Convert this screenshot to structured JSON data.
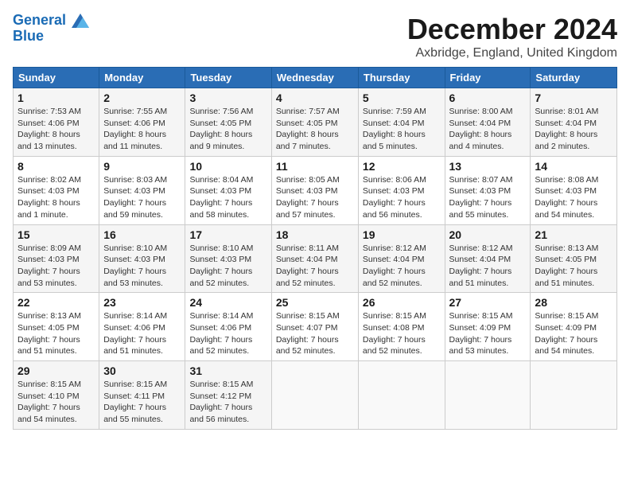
{
  "logo": {
    "line1": "General",
    "line2": "Blue"
  },
  "title": "December 2024",
  "subtitle": "Axbridge, England, United Kingdom",
  "colors": {
    "header_bg": "#2a6db5",
    "accent": "#1a6bb5"
  },
  "days_of_week": [
    "Sunday",
    "Monday",
    "Tuesday",
    "Wednesday",
    "Thursday",
    "Friday",
    "Saturday"
  ],
  "weeks": [
    [
      {
        "day": "1",
        "sunrise": "7:53 AM",
        "sunset": "4:06 PM",
        "daylight": "8 hours and 13 minutes."
      },
      {
        "day": "2",
        "sunrise": "7:55 AM",
        "sunset": "4:06 PM",
        "daylight": "8 hours and 11 minutes."
      },
      {
        "day": "3",
        "sunrise": "7:56 AM",
        "sunset": "4:05 PM",
        "daylight": "8 hours and 9 minutes."
      },
      {
        "day": "4",
        "sunrise": "7:57 AM",
        "sunset": "4:05 PM",
        "daylight": "8 hours and 7 minutes."
      },
      {
        "day": "5",
        "sunrise": "7:59 AM",
        "sunset": "4:04 PM",
        "daylight": "8 hours and 5 minutes."
      },
      {
        "day": "6",
        "sunrise": "8:00 AM",
        "sunset": "4:04 PM",
        "daylight": "8 hours and 4 minutes."
      },
      {
        "day": "7",
        "sunrise": "8:01 AM",
        "sunset": "4:04 PM",
        "daylight": "8 hours and 2 minutes."
      }
    ],
    [
      {
        "day": "8",
        "sunrise": "8:02 AM",
        "sunset": "4:03 PM",
        "daylight": "8 hours and 1 minute."
      },
      {
        "day": "9",
        "sunrise": "8:03 AM",
        "sunset": "4:03 PM",
        "daylight": "7 hours and 59 minutes."
      },
      {
        "day": "10",
        "sunrise": "8:04 AM",
        "sunset": "4:03 PM",
        "daylight": "7 hours and 58 minutes."
      },
      {
        "day": "11",
        "sunrise": "8:05 AM",
        "sunset": "4:03 PM",
        "daylight": "7 hours and 57 minutes."
      },
      {
        "day": "12",
        "sunrise": "8:06 AM",
        "sunset": "4:03 PM",
        "daylight": "7 hours and 56 minutes."
      },
      {
        "day": "13",
        "sunrise": "8:07 AM",
        "sunset": "4:03 PM",
        "daylight": "7 hours and 55 minutes."
      },
      {
        "day": "14",
        "sunrise": "8:08 AM",
        "sunset": "4:03 PM",
        "daylight": "7 hours and 54 minutes."
      }
    ],
    [
      {
        "day": "15",
        "sunrise": "8:09 AM",
        "sunset": "4:03 PM",
        "daylight": "7 hours and 53 minutes."
      },
      {
        "day": "16",
        "sunrise": "8:10 AM",
        "sunset": "4:03 PM",
        "daylight": "7 hours and 53 minutes."
      },
      {
        "day": "17",
        "sunrise": "8:10 AM",
        "sunset": "4:03 PM",
        "daylight": "7 hours and 52 minutes."
      },
      {
        "day": "18",
        "sunrise": "8:11 AM",
        "sunset": "4:04 PM",
        "daylight": "7 hours and 52 minutes."
      },
      {
        "day": "19",
        "sunrise": "8:12 AM",
        "sunset": "4:04 PM",
        "daylight": "7 hours and 52 minutes."
      },
      {
        "day": "20",
        "sunrise": "8:12 AM",
        "sunset": "4:04 PM",
        "daylight": "7 hours and 51 minutes."
      },
      {
        "day": "21",
        "sunrise": "8:13 AM",
        "sunset": "4:05 PM",
        "daylight": "7 hours and 51 minutes."
      }
    ],
    [
      {
        "day": "22",
        "sunrise": "8:13 AM",
        "sunset": "4:05 PM",
        "daylight": "7 hours and 51 minutes."
      },
      {
        "day": "23",
        "sunrise": "8:14 AM",
        "sunset": "4:06 PM",
        "daylight": "7 hours and 51 minutes."
      },
      {
        "day": "24",
        "sunrise": "8:14 AM",
        "sunset": "4:06 PM",
        "daylight": "7 hours and 52 minutes."
      },
      {
        "day": "25",
        "sunrise": "8:15 AM",
        "sunset": "4:07 PM",
        "daylight": "7 hours and 52 minutes."
      },
      {
        "day": "26",
        "sunrise": "8:15 AM",
        "sunset": "4:08 PM",
        "daylight": "7 hours and 52 minutes."
      },
      {
        "day": "27",
        "sunrise": "8:15 AM",
        "sunset": "4:09 PM",
        "daylight": "7 hours and 53 minutes."
      },
      {
        "day": "28",
        "sunrise": "8:15 AM",
        "sunset": "4:09 PM",
        "daylight": "7 hours and 54 minutes."
      }
    ],
    [
      {
        "day": "29",
        "sunrise": "8:15 AM",
        "sunset": "4:10 PM",
        "daylight": "7 hours and 54 minutes."
      },
      {
        "day": "30",
        "sunrise": "8:15 AM",
        "sunset": "4:11 PM",
        "daylight": "7 hours and 55 minutes."
      },
      {
        "day": "31",
        "sunrise": "8:15 AM",
        "sunset": "4:12 PM",
        "daylight": "7 hours and 56 minutes."
      },
      null,
      null,
      null,
      null
    ]
  ]
}
